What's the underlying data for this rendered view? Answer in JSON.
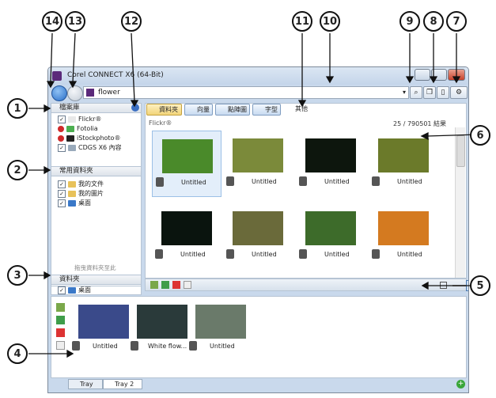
{
  "window": {
    "title": "Corel CONNECT X6 (64-Bit)"
  },
  "address": {
    "value": "flower"
  },
  "callouts": [
    "1",
    "2",
    "3",
    "4",
    "5",
    "6",
    "7",
    "8",
    "9",
    "10",
    "11",
    "12",
    "13",
    "14"
  ],
  "library": {
    "header": "檔案庫",
    "items": [
      {
        "label": "Flickr®",
        "checked": true
      },
      {
        "label": "Fotolia",
        "checked": false
      },
      {
        "label": "iStockphoto®",
        "checked": false
      },
      {
        "label": "CDGS X6 內容",
        "checked": true
      }
    ]
  },
  "favorites": {
    "header": "常用資料夾",
    "items": [
      {
        "label": "我的文件"
      },
      {
        "label": "我的圖片"
      },
      {
        "label": "桌面"
      }
    ],
    "drop_hint": "拖曳資料夾至此"
  },
  "folders": {
    "header": "資料夾",
    "current": "桌面"
  },
  "content_tabs": [
    "資料夾",
    "向量",
    "點陣圖",
    "字型",
    "其他"
  ],
  "results": {
    "source": "Flickr®",
    "count": "25 / 790501 結果"
  },
  "grid": [
    {
      "label": "Untitled",
      "color": "#4a8a2a"
    },
    {
      "label": "Untitled",
      "color": "#7b8a3a"
    },
    {
      "label": "Untitled",
      "color": "#0d160d"
    },
    {
      "label": "Untitled",
      "color": "#6b7a2a"
    },
    {
      "label": "Untitled",
      "color": "#0a140e"
    },
    {
      "label": "Untitled",
      "color": "#6a6a3a"
    },
    {
      "label": "Untitled",
      "color": "#3d6b2a"
    },
    {
      "label": "Untitled",
      "color": "#d47a20"
    }
  ],
  "tray": {
    "items": [
      {
        "label": "Untitled",
        "color": "#3a4a8a"
      },
      {
        "label": "White flow...",
        "color": "#2a3a3a"
      },
      {
        "label": "Untitled",
        "color": "#6a7a6a"
      }
    ],
    "tabs": [
      "Tray",
      "Tray 2"
    ]
  }
}
